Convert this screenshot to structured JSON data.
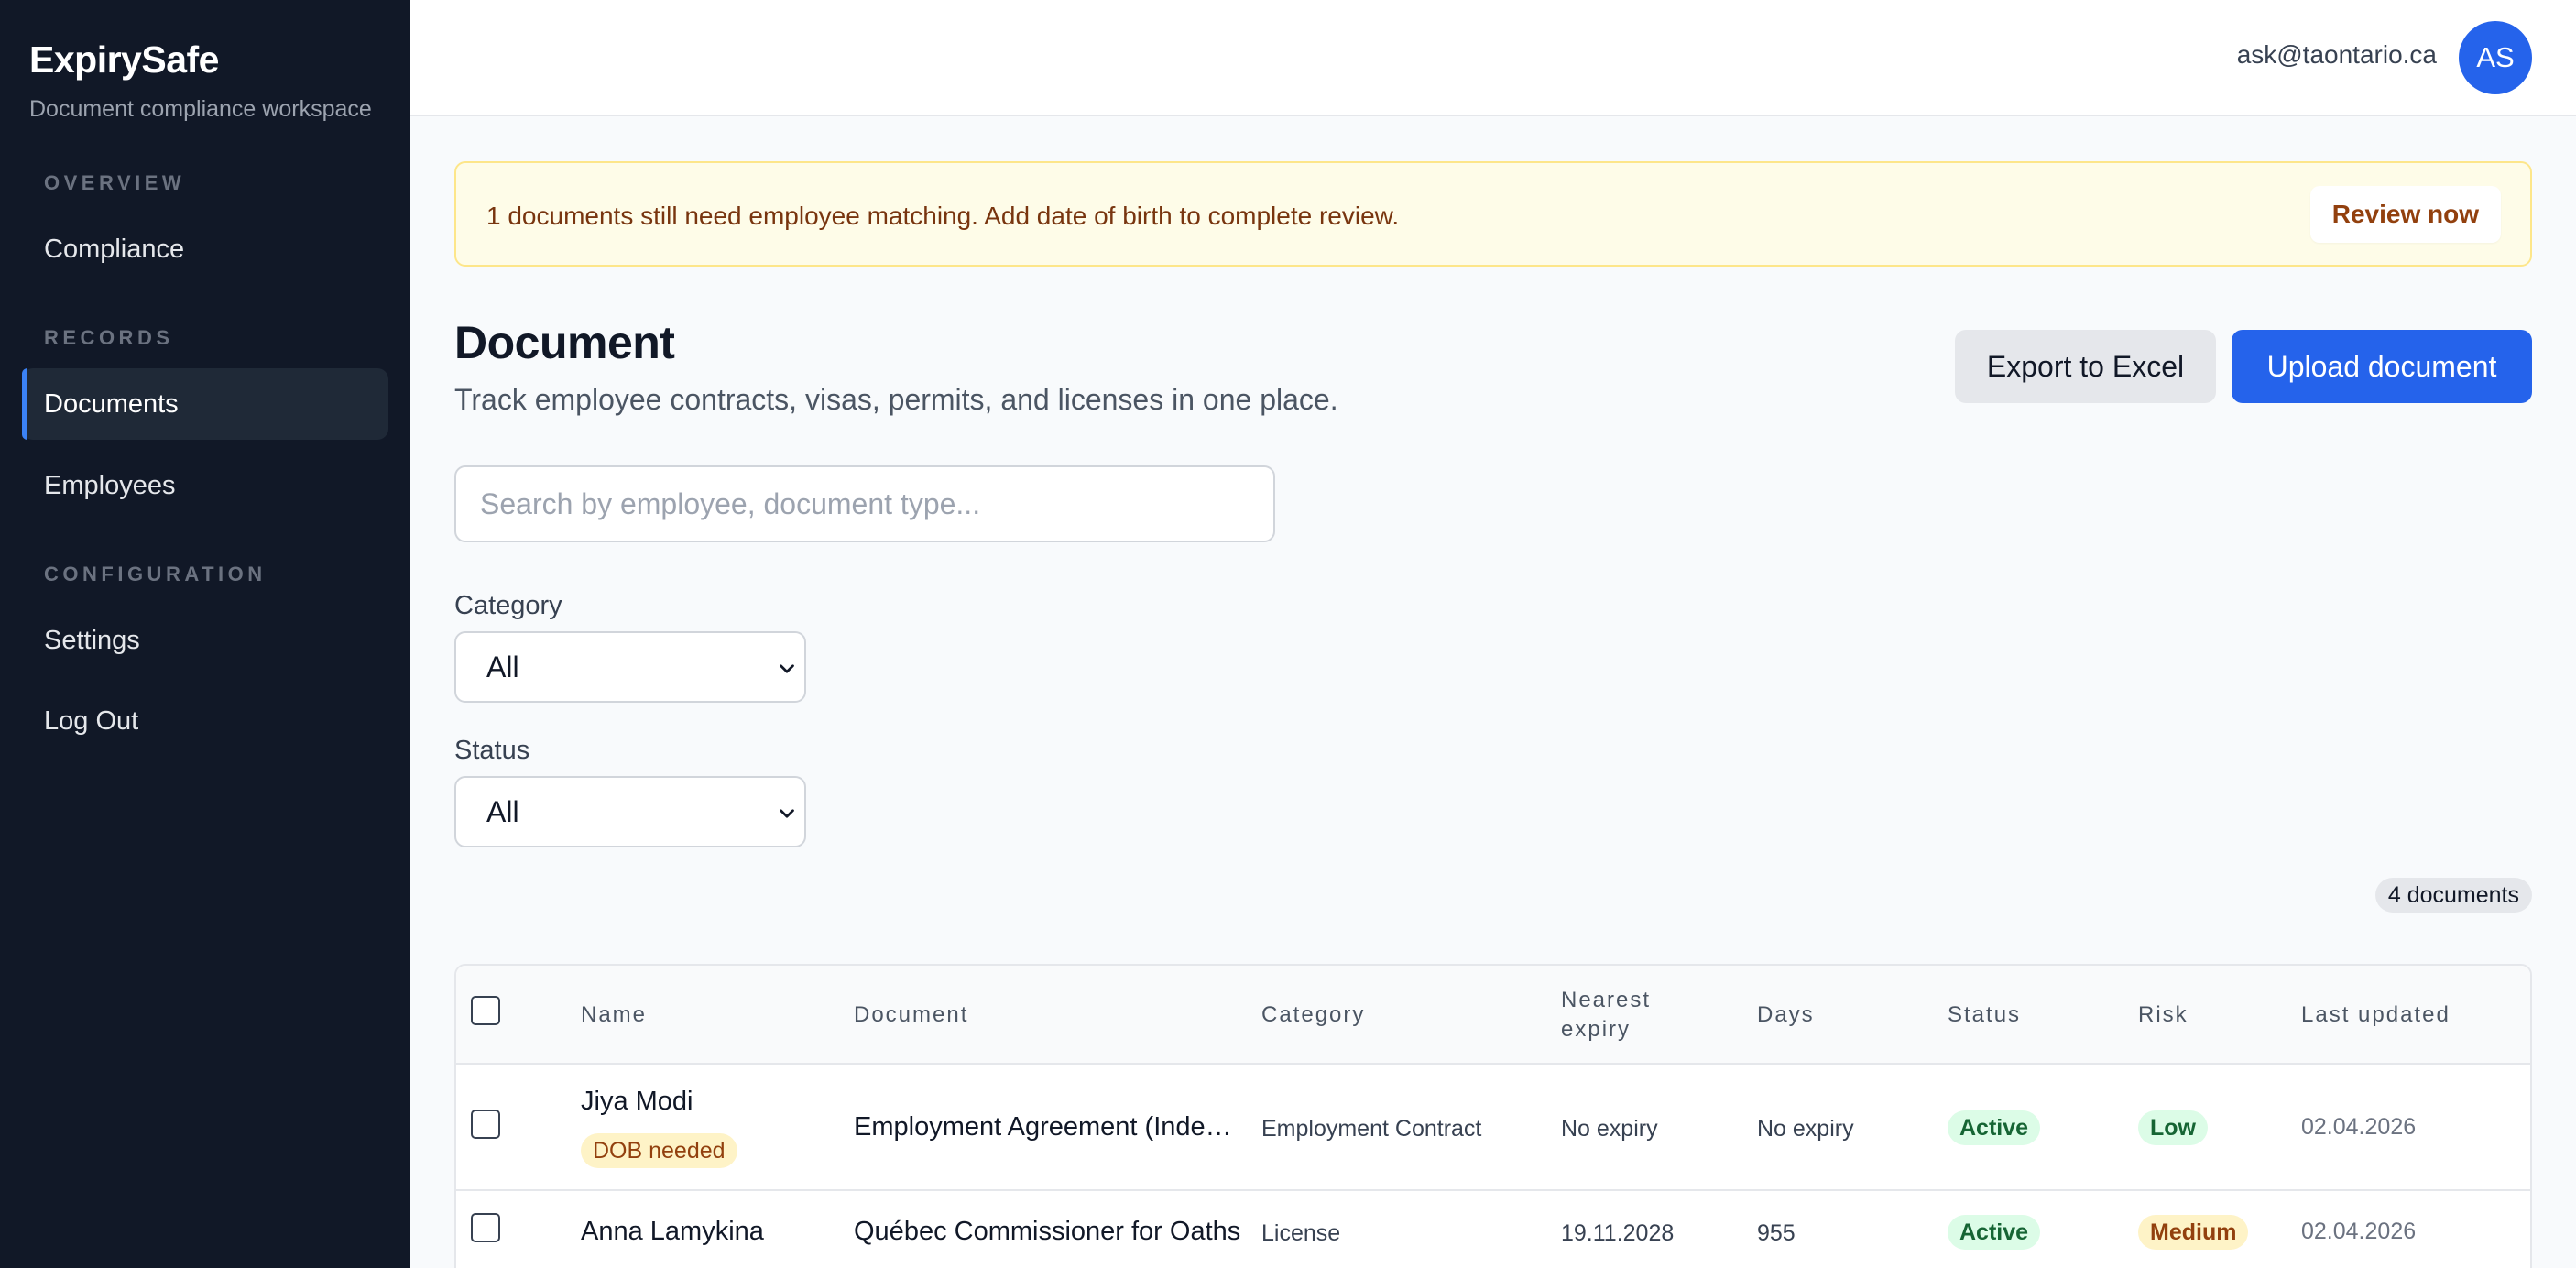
{
  "app": {
    "brand": "ExpirySafe",
    "tagline": "Document compliance workspace"
  },
  "sidebar": {
    "sections": [
      {
        "label": "OVERVIEW"
      },
      {
        "label": "RECORDS"
      },
      {
        "label": "CONFIGURATION"
      }
    ],
    "items": [
      {
        "label": "Compliance",
        "active": false
      },
      {
        "label": "Documents",
        "active": true
      },
      {
        "label": "Employees",
        "active": false
      },
      {
        "label": "Settings",
        "active": false
      },
      {
        "label": "Log Out",
        "active": false
      }
    ]
  },
  "header": {
    "email": "ask@taontario.ca",
    "avatar_initials": "AS"
  },
  "banner": {
    "text": "1 documents still need employee matching. Add date of birth to complete review.",
    "action": "Review now"
  },
  "page": {
    "title": "Document",
    "subtitle": "Track employee contracts, visas, permits, and licenses in one place.",
    "export_label": "Export to Excel",
    "upload_label": "Upload document"
  },
  "filters": {
    "search_placeholder": "Search by employee, document type...",
    "category_label": "Category",
    "category_value": "All",
    "status_label": "Status",
    "status_value": "All",
    "count": "4 documents"
  },
  "table": {
    "columns": [
      "Name",
      "Document",
      "Category",
      "Nearest expiry",
      "Days",
      "Status",
      "Risk",
      "Last updated"
    ],
    "rows": [
      {
        "name": "Jiya Modi",
        "flag": "DOB needed",
        "document": "Employment Agreement (Independent Contractor)",
        "category": "Employment Contract",
        "nearest_expiry": "No expiry",
        "days": "No expiry",
        "status": "Active",
        "risk": "Low",
        "last_updated": "02.04.2026"
      },
      {
        "name": "Anna Lamykina",
        "flag": "",
        "document": "Québec Commissioner for Oaths",
        "category": "License",
        "nearest_expiry": "19.11.2028",
        "days": "955",
        "status": "Active",
        "risk": "Medium",
        "last_updated": "02.04.2026"
      }
    ]
  },
  "colors": {
    "sidebar_bg": "#111827",
    "accent": "#2563eb",
    "banner_bg": "#fefce8",
    "active_green": "#dcfce7",
    "medium_amber": "#fef3c7"
  }
}
